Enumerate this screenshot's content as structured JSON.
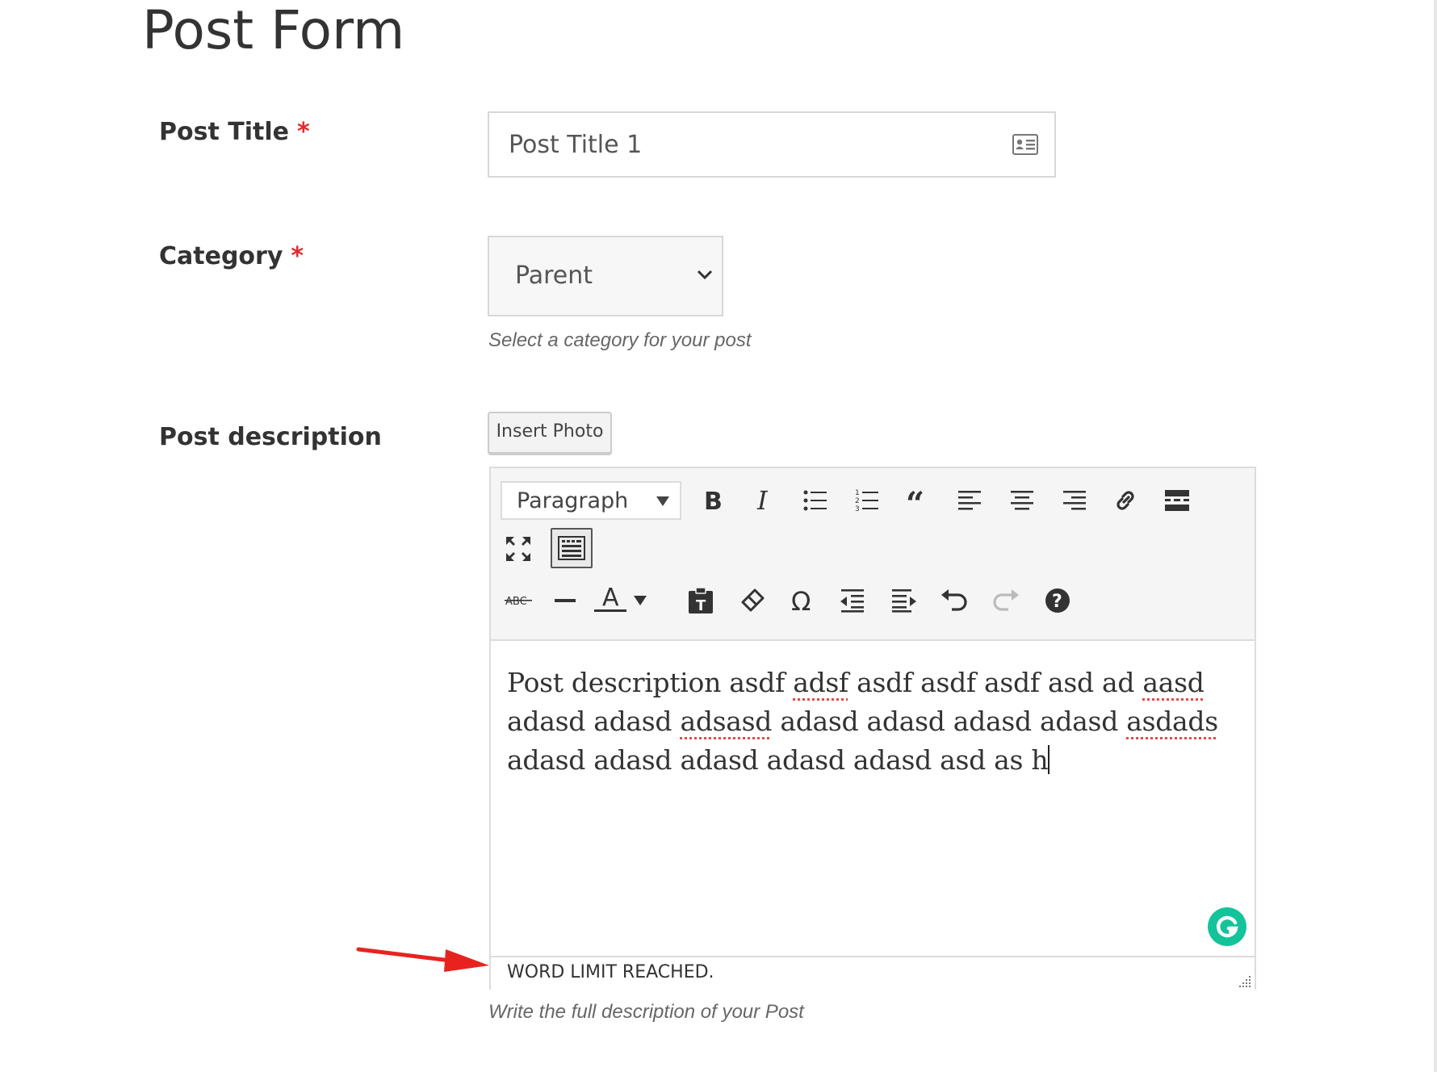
{
  "page": {
    "title": "Post Form"
  },
  "fields": {
    "post_title": {
      "label": "Post Title",
      "required_mark": "*",
      "value": "Post Title 1"
    },
    "category": {
      "label": "Category",
      "required_mark": "*",
      "selected": "Parent",
      "help": "Select a category for your post"
    },
    "description": {
      "label": "Post description",
      "insert_photo_label": "Insert Photo",
      "format_selected": "Paragraph",
      "content": [
        {
          "t": "Post description asdf "
        },
        {
          "t": "adsf",
          "spell": true
        },
        {
          "t": " asdf asdf asdf asd ad "
        },
        {
          "t": "aasd",
          "spell": true
        },
        {
          "t": " adasd adasd "
        },
        {
          "t": "adsasd",
          "spell": true
        },
        {
          "t": " adasd adasd adasd adasd "
        },
        {
          "t": "asdads",
          "spell": true
        },
        {
          "t": " adasd adasd adasd adasd adasd asd as h"
        }
      ],
      "status": "WORD LIMIT REACHED.",
      "help": "Write the full description of your Post"
    }
  },
  "toolbar": {
    "row1": [
      "bold-icon",
      "italic-icon",
      "bullet-list-icon",
      "numbered-list-icon",
      "blockquote-icon",
      "align-left-icon",
      "align-center-icon",
      "align-right-icon",
      "link-icon",
      "read-more-icon"
    ],
    "row2": [
      "fullscreen-icon",
      "toolbar-toggle-icon"
    ],
    "row3": [
      "strikethrough-icon",
      "horizontal-line-icon",
      "text-color-icon",
      "text-color-dropdown-icon",
      "paste-as-text-icon",
      "clear-formatting-icon",
      "special-character-icon",
      "outdent-icon",
      "indent-icon",
      "undo-icon",
      "redo-icon",
      "help-icon"
    ]
  },
  "colors": {
    "required": "#e32a2a",
    "grammarly": "#15c39a",
    "annotation_arrow": "#e8231f",
    "spell_underline": "#e34a4a"
  }
}
